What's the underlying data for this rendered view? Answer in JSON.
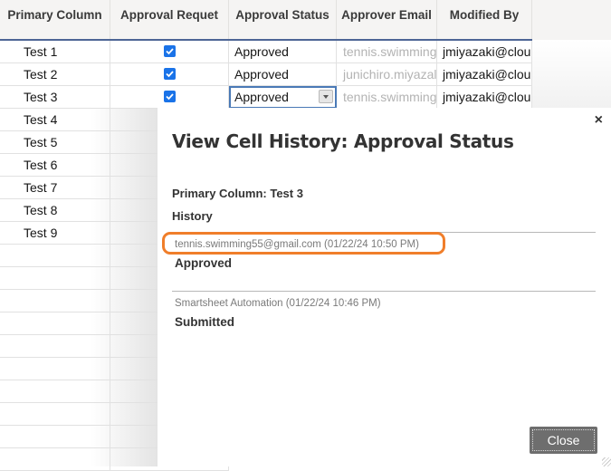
{
  "grid": {
    "columns": [
      "Primary Column",
      "Approval Requet",
      "Approval Status",
      "Approver Email",
      "Modified By"
    ],
    "rows": [
      {
        "primary": "Test 1",
        "approval_request": true,
        "approval_status": "Approved",
        "approver_email": "tennis.swimming",
        "modified_by": "jmiyazaki@clou"
      },
      {
        "primary": "Test 2",
        "approval_request": true,
        "approval_status": "Approved",
        "approver_email": "junichiro.miyazal",
        "modified_by": "jmiyazaki@clou"
      },
      {
        "primary": "Test 3",
        "approval_request": true,
        "approval_status": "Approved",
        "approver_email": "tennis.swimming",
        "modified_by": "jmiyazaki@clou"
      },
      {
        "primary": "Test 4"
      },
      {
        "primary": "Test 5"
      },
      {
        "primary": "Test 6"
      },
      {
        "primary": "Test 7"
      },
      {
        "primary": "Test 8"
      },
      {
        "primary": "Test 9"
      }
    ],
    "active_cell": {
      "row": 3,
      "column": "Approval Status"
    }
  },
  "modal": {
    "title": "View Cell History: Approval Status",
    "close_icon": "×",
    "primary_label": "Primary Column: Test 3",
    "history_label": "History",
    "entries": [
      {
        "meta": "tennis.swimming55@gmail.com (01/22/24 10:50 PM)",
        "value": "Approved",
        "highlighted": true
      },
      {
        "meta": "Smartsheet Automation (01/22/24 10:46 PM)",
        "value": "Submitted",
        "highlighted": false
      }
    ],
    "close_button": "Close",
    "highlight_color": "#f07e2a"
  }
}
